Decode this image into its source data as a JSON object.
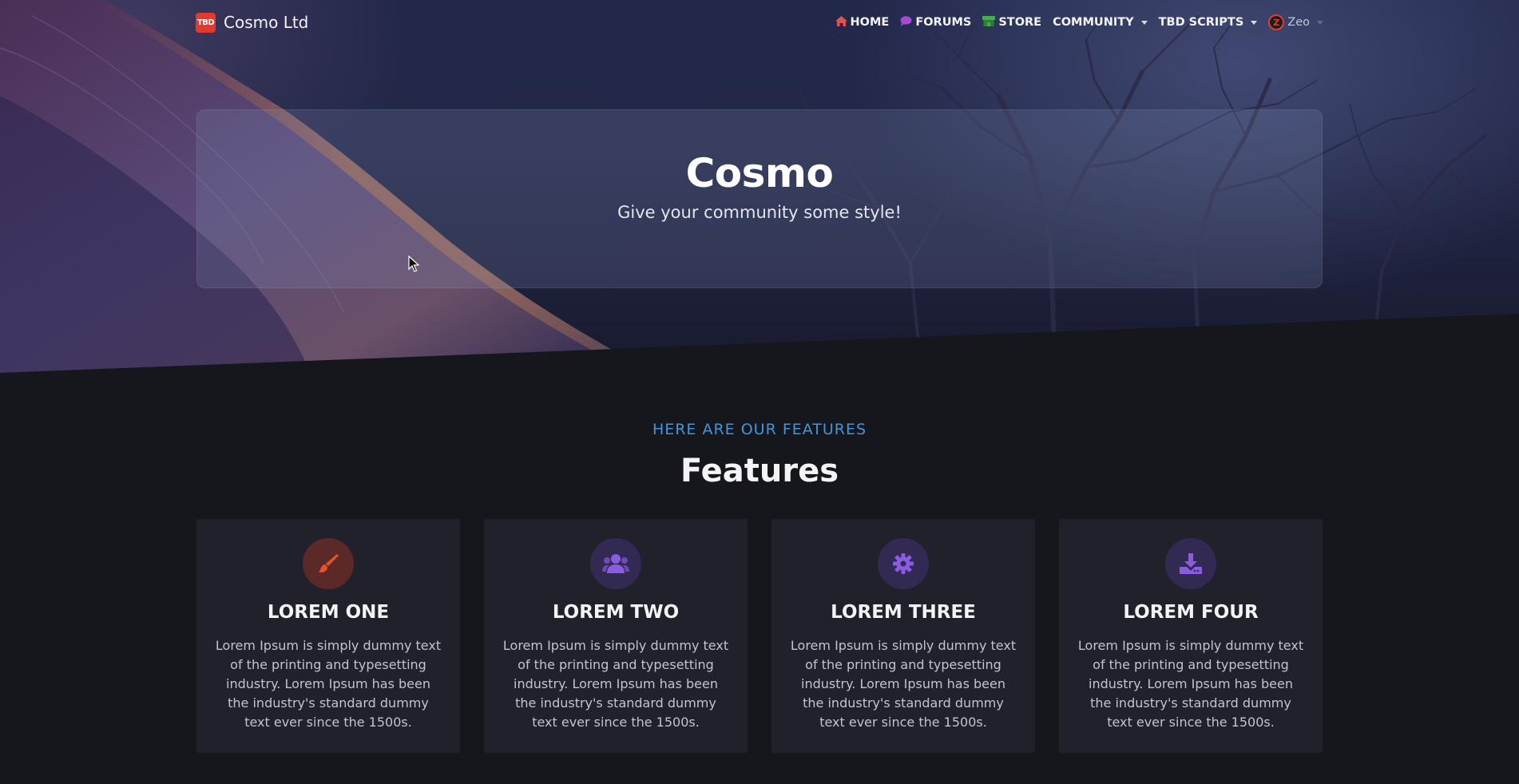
{
  "navbar": {
    "brand_logo_text": "TBD",
    "brand_name": "Cosmo Ltd",
    "items": [
      {
        "label": "HOME",
        "icon": "home-icon"
      },
      {
        "label": "FORUMS",
        "icon": "chat-bubble-icon"
      },
      {
        "label": "STORE",
        "icon": "store-awning-icon"
      },
      {
        "label": "COMMUNITY",
        "icon": "chevron-down-icon"
      },
      {
        "label": "TBD SCRIPTS",
        "icon": "chevron-down-icon"
      }
    ],
    "user": {
      "name": "Zeo",
      "avatar_letter": "Z"
    }
  },
  "hero": {
    "title": "Cosmo",
    "subtitle": "Give your community some style!"
  },
  "features": {
    "kicker": "HERE ARE OUR FEATURES",
    "title": "Features",
    "cards": [
      {
        "title": "LOREM ONE",
        "icon": "paintbrush-icon",
        "accent": "#e8532a",
        "text": "Lorem Ipsum is simply dummy text of the printing and typesetting industry. Lorem Ipsum has been the industry's standard dummy text ever since the 1500s."
      },
      {
        "title": "LOREM TWO",
        "icon": "users-icon",
        "accent": "#8a5ce0",
        "text": "Lorem Ipsum is simply dummy text of the printing and typesetting industry. Lorem Ipsum has been the industry's standard dummy text ever since the 1500s."
      },
      {
        "title": "LOREM THREE",
        "icon": "gear-icon",
        "accent": "#8a5ce0",
        "text": "Lorem Ipsum is simply dummy text of the printing and typesetting industry. Lorem Ipsum has been the industry's standard dummy text ever since the 1500s."
      },
      {
        "title": "LOREM FOUR",
        "icon": "download-icon",
        "accent": "#8a5ce0",
        "text": "Lorem Ipsum is simply dummy text of the printing and typesetting industry. Lorem Ipsum has been the industry's standard dummy text ever since the 1500s."
      }
    ]
  },
  "colors": {
    "page_background": "#16161d",
    "card_background": "#21212b",
    "kicker": "#3d96e0",
    "brand_red": "#e5392d"
  }
}
